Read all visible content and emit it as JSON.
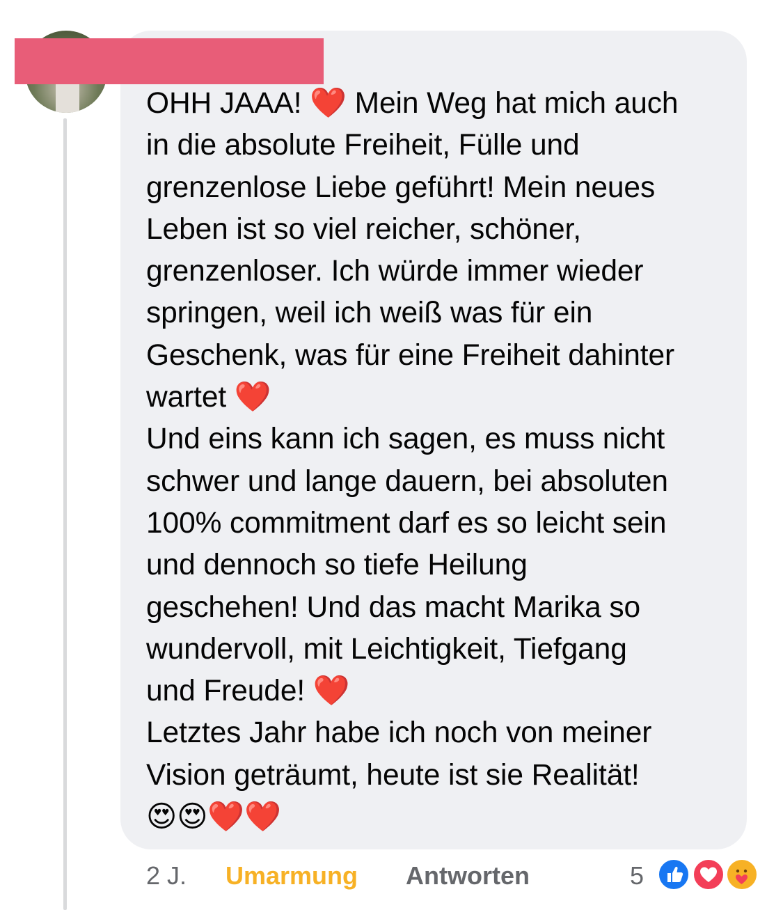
{
  "comment": {
    "author_name_redacted": true,
    "text": "OHH JAAA! ❤️ Mein Weg hat mich auch\nin die absolute Freiheit, Fülle und\ngrenzenlose Liebe geführt! Mein neues\nLeben ist so viel reicher, schöner,\ngrenzenloser. Ich würde immer wieder\nspringen, weil ich weiß was für ein\nGeschenk, was für eine Freiheit dahinter\nwartet ❤️\nUnd eins kann ich sagen, es muss nicht\nschwer und lange dauern, bei absoluten\n100% commitment darf es so leicht sein\nund dennoch so tiefe Heilung\ngeschehen! Und das macht Marika so\nwundervoll, mit Leichtigkeit, Tiefgang\nund Freude! ❤️\nLetztes Jahr habe ich noch von meiner\nVision geträumt, heute ist sie Realität!\n😍😍❤️❤️"
  },
  "meta": {
    "time": "2 J.",
    "reaction_label": "Umarmung",
    "reply_label": "Antworten",
    "reaction_count": "5"
  },
  "reactions": [
    {
      "name": "like",
      "icon": "thumbs-up-icon",
      "color": "#1877f2"
    },
    {
      "name": "love",
      "icon": "heart-icon",
      "color": "#f33e58"
    },
    {
      "name": "care",
      "icon": "care-hug-icon",
      "color": "#f7b125"
    }
  ],
  "colors": {
    "bubble": "#eff0f3",
    "reaction_active": "#f7b125",
    "secondary_text": "#65676b",
    "redaction": "#e85d78"
  }
}
